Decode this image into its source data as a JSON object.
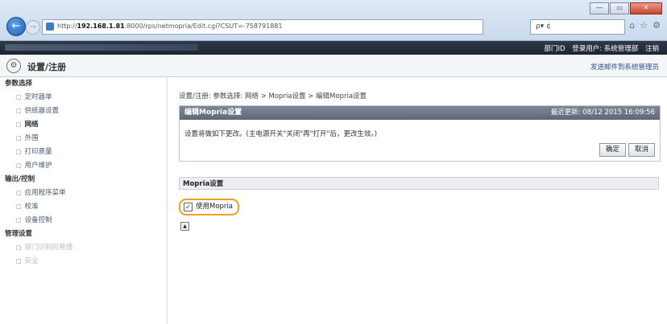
{
  "browser": {
    "url_prefix": "http://",
    "url_host": "192.168.1.81",
    "url_rest": ":8000/rps/netmopria/Edit.cgi?CSUT=-758791881",
    "search_text": "ρ▾ ¢",
    "window_controls": [
      "—",
      "▭",
      "✕"
    ],
    "tool_icons": [
      "⌂",
      "☆",
      "⚙"
    ]
  },
  "strip": {
    "dept_label": "部门ID",
    "user_label": "登录用户: 系统管理部",
    "logout_label": "注销"
  },
  "header": {
    "title": "设置/注册",
    "mail_link": "发送邮件到系统管理员"
  },
  "sidebar": {
    "sections": [
      {
        "label": "参数选择",
        "items": [
          "定时器单",
          "供纸器设置",
          "网络",
          "外围",
          "打印质量",
          "用户维护"
        ],
        "active": 2
      },
      {
        "label": "输出/控制",
        "items": [
          "应用程序菜单",
          "校准",
          "设备控制"
        ]
      },
      {
        "label": "管理设置",
        "items": [
          "部门识别码管理",
          "安全"
        ]
      }
    ]
  },
  "main": {
    "breadcrumb": "设置/注册: 参数选择: 网络 > Mopria设置 > 编辑Mopria设置",
    "panel_title": "编辑Mopria设置",
    "last_update": "最近更新: 08/12 2015 16:09:56",
    "note": "设置将做如下更改。(主电源开关\"关闭\"再\"打开\"后，更改生效。)",
    "ok_button": "确定",
    "cancel_button": "取消",
    "section_title": "Mopria设置",
    "checkbox_label": "使用Mopria",
    "checkbox_checked": true,
    "top_button": "▲"
  }
}
